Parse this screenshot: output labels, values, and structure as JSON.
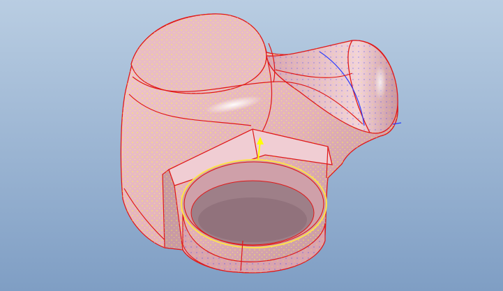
{
  "viewport": {
    "background_top": "#b9cde2",
    "background_bottom": "#7f9ec4",
    "model": {
      "surface_color": "#e7b6bf",
      "edge_color": "#e01818",
      "mesh_color": "#ffff33",
      "mesh_secondary_color": "#2a3cff",
      "datum_arrow_color": "#ffff00",
      "highlight_color": "#ffffff"
    }
  }
}
